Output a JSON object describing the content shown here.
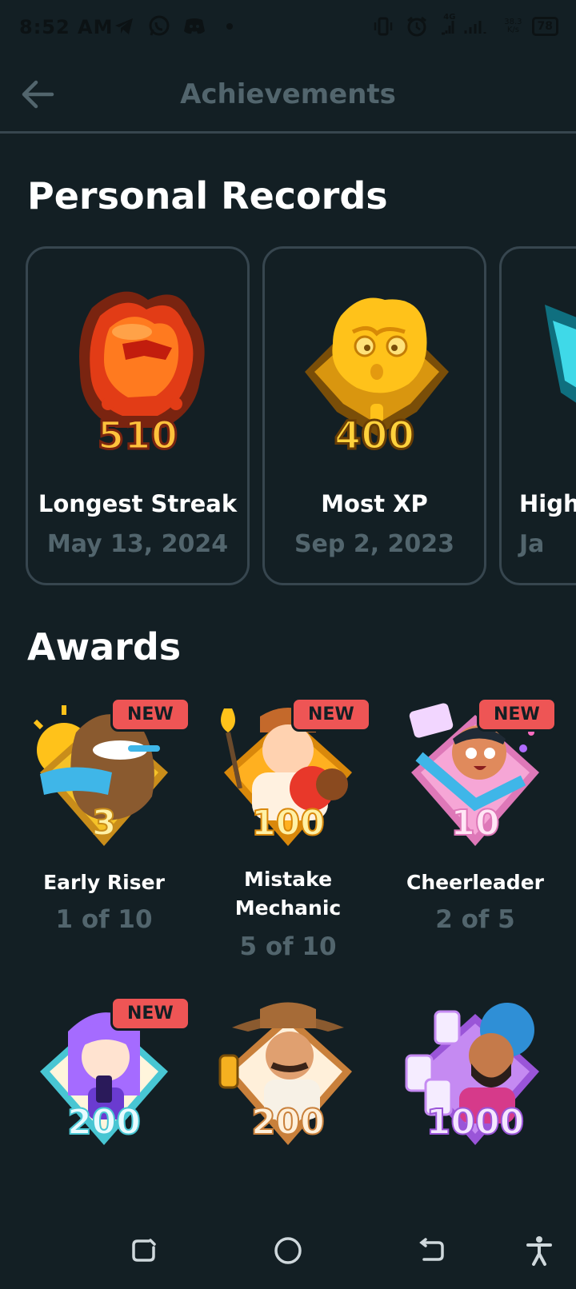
{
  "status_bar": {
    "time": "8:52 AM",
    "left_icons": [
      "telegram-icon",
      "whatsapp-icon",
      "discord-icon",
      "dot-icon"
    ],
    "right_icons": [
      "vibrate-icon",
      "alarm-icon",
      "signal-icon"
    ],
    "network_label": "4G",
    "net_speed_value": "38.3",
    "net_speed_unit": "K/s",
    "battery": "78"
  },
  "app_bar": {
    "title": "Achievements"
  },
  "personal_records": {
    "heading": "Personal Records",
    "cards": [
      {
        "label": "Longest Streak",
        "date": "May 13, 2024",
        "value": "510",
        "icon": "flame-owl-badge"
      },
      {
        "label": "Most XP",
        "date": "Sep 2, 2023",
        "value": "400",
        "icon": "gold-owl-badge"
      },
      {
        "label": "High",
        "date": "Ja",
        "icon": "teal-badge"
      }
    ]
  },
  "awards": {
    "heading": "Awards",
    "new_label": "NEW",
    "items": [
      {
        "title": "Early Riser",
        "progress": "1 of 10",
        "value": "3",
        "is_new": true,
        "colors": {
          "badge": "#f5c228",
          "rim": "#c98d1a",
          "text": "#fff1a6"
        }
      },
      {
        "title": "Mistake Mechanic",
        "title_lines": [
          "Mistake",
          "Mechanic"
        ],
        "progress": "5 of 10",
        "value": "100",
        "is_new": true,
        "colors": {
          "badge": "#ffb020",
          "rim": "#d9880b",
          "text": "#fff1a6"
        }
      },
      {
        "title": "Cheerleader",
        "progress": "2 of 5",
        "value": "10",
        "is_new": true,
        "colors": {
          "badge": "#f6a6d6",
          "rim": "#de78b8",
          "text": "#ffe6f5"
        }
      },
      {
        "title": "",
        "progress": "",
        "value": "200",
        "is_new": true,
        "colors": {
          "badge": "#8fe6ef",
          "rim": "#48c6d3",
          "text": "#e9fbff"
        }
      },
      {
        "title": "",
        "progress": "",
        "value": "200",
        "is_new": false,
        "colors": {
          "badge": "#f0b46c",
          "rim": "#c9803b",
          "text": "#fff0da"
        }
      },
      {
        "title": "",
        "progress": "",
        "value": "1000",
        "is_new": false,
        "colors": {
          "badge": "#c58af2",
          "rim": "#9a55d8",
          "text": "#f4e6ff"
        }
      }
    ]
  },
  "nav_bar": {
    "buttons": [
      "recents-icon",
      "home-icon",
      "back-icon",
      "accessibility-icon"
    ]
  },
  "colors": {
    "background": "#131f24",
    "divider": "#37464f",
    "muted_text": "#52656d",
    "new_badge": "#ee5555"
  }
}
